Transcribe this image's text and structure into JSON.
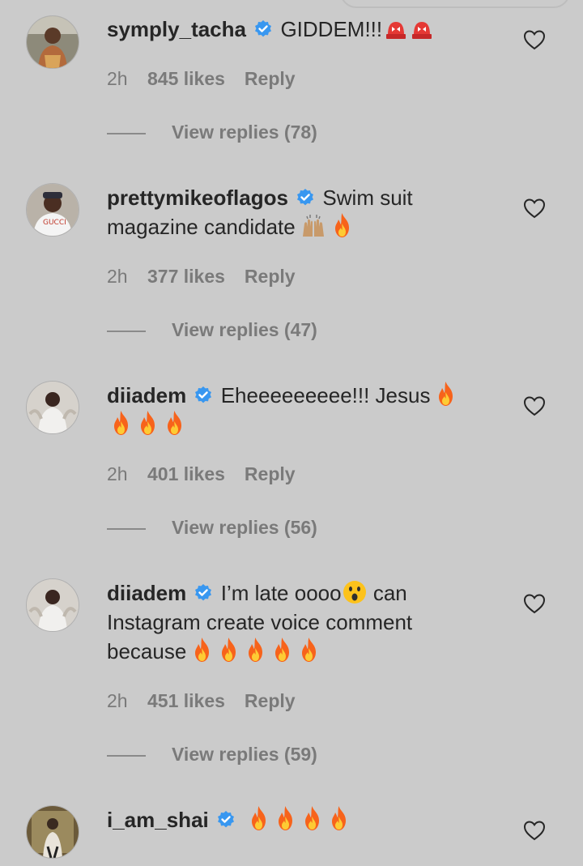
{
  "comments": [
    {
      "username": "symply_tacha",
      "text": "GIDDEM!!!",
      "emoji": [
        "police-car-light",
        "police-car-light"
      ],
      "time": "2h",
      "likes": "845 likes",
      "reply": "Reply",
      "view_replies": "View replies (78)"
    },
    {
      "username": "prettymikeoflagos",
      "text": "Swim suit magazine candidate",
      "emoji": [
        "raising-hands",
        "fire"
      ],
      "time": "2h",
      "likes": "377 likes",
      "reply": "Reply",
      "view_replies": "View replies (47)"
    },
    {
      "username": "diiadem",
      "text": "Eheeeeeeeee!!! Jesus",
      "emoji": [
        "fire",
        "fire",
        "fire",
        "fire"
      ],
      "time": "2h",
      "likes": "401 likes",
      "reply": "Reply",
      "view_replies": "View replies (56)"
    },
    {
      "username": "diiadem",
      "text_before": "I’m late oooo",
      "text_after": "can Instagram create voice comment because",
      "emoji": [
        "astonished-face",
        "fire",
        "fire",
        "fire",
        "fire",
        "fire"
      ],
      "time": "2h",
      "likes": "451 likes",
      "reply": "Reply",
      "view_replies": "View replies (59)"
    },
    {
      "username": "i_am_shai",
      "text": "",
      "emoji": [
        "fire",
        "fire",
        "fire",
        "fire"
      ]
    }
  ],
  "colors": {
    "background": "#cbcbcb",
    "verified": "#3897f0",
    "muted": "#7a7a7a",
    "text": "#262626"
  },
  "icons": {
    "like": "heart-outline-icon",
    "verified": "verified-badge-icon"
  }
}
